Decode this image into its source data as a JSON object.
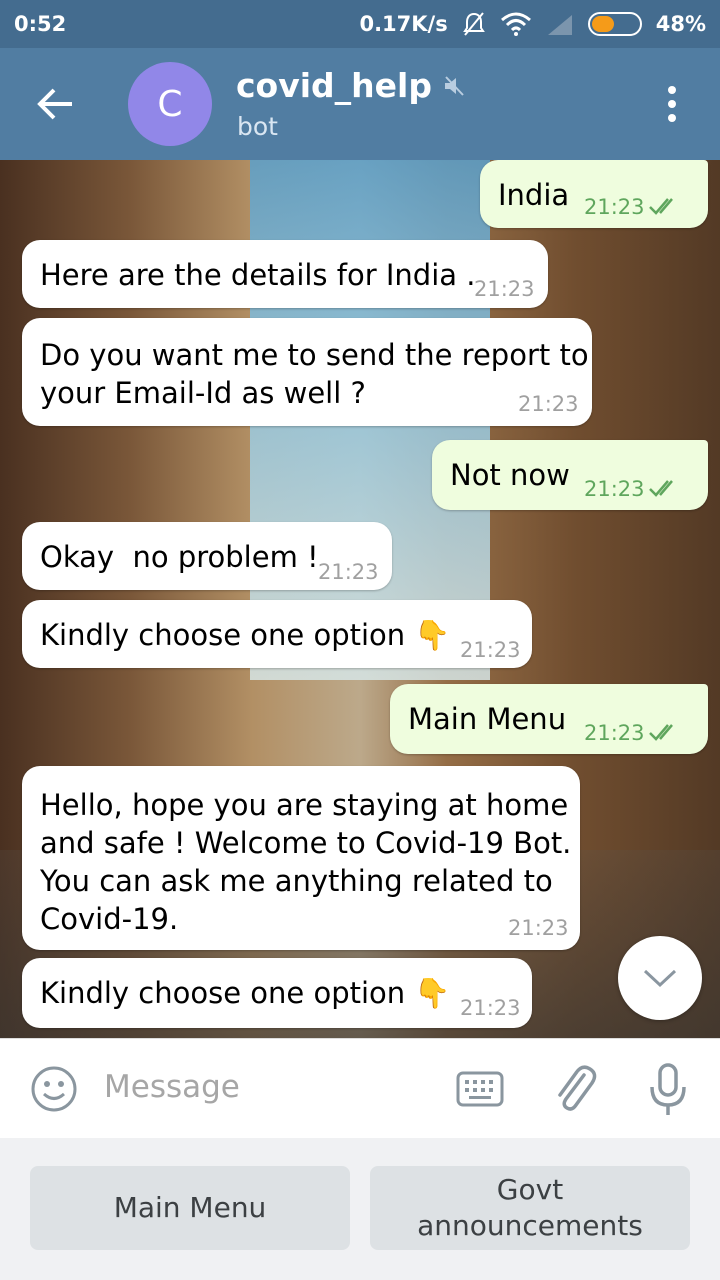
{
  "status_bar": {
    "time": "0:52",
    "net_speed": "0.17K/s",
    "battery": "48%",
    "battery_level": 0.48
  },
  "header": {
    "avatar_letter": "C",
    "title": "covid_help",
    "subtitle": "bot"
  },
  "messages": [
    {
      "dir": "out",
      "text": "India",
      "time": "21:23"
    },
    {
      "dir": "in",
      "text": "Here are the details for India .",
      "time": "21:23"
    },
    {
      "dir": "in",
      "text": "Do you want me to send the report to\nyour Email-Id as well ?",
      "time": "21:23"
    },
    {
      "dir": "out",
      "text": "Not now",
      "time": "21:23"
    },
    {
      "dir": "in",
      "text": "Okay  no problem !",
      "time": "21:23"
    },
    {
      "dir": "in",
      "text": "Kindly choose one option 👇",
      "time": "21:23"
    },
    {
      "dir": "out",
      "text": "Main Menu",
      "time": "21:23"
    },
    {
      "dir": "in",
      "text": "Hello, hope you are staying at home\nand safe ! Welcome to Covid-19 Bot.\nYou can ask me anything related to\nCovid-19.",
      "time": "21:23"
    },
    {
      "dir": "in",
      "text": "Kindly choose one option 👇",
      "time": "21:23"
    }
  ],
  "input": {
    "placeholder": "Message"
  },
  "keyboard": {
    "buttons": [
      "Main Menu",
      "Govt\nannouncements"
    ]
  },
  "colors": {
    "header": "#517da2",
    "status_bar": "#446c8f",
    "outgoing_bubble": "#effdde",
    "incoming_bubble": "#ffffff",
    "avatar": "#9187e8"
  }
}
